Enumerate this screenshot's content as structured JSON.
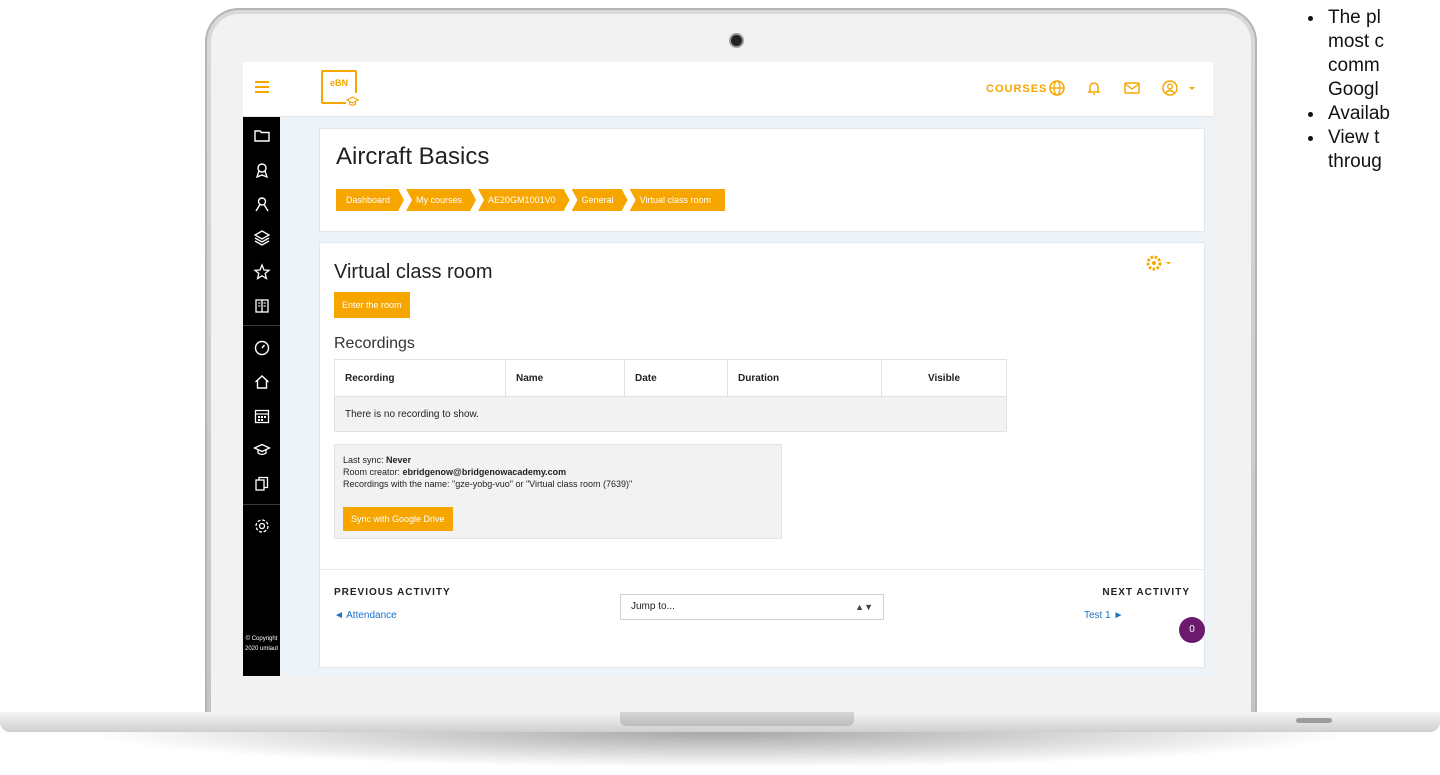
{
  "topbar": {
    "logo_text": "eBN",
    "courses_label": "COURSES"
  },
  "sidebar": {
    "copyright": "© Copyright 2020 umlaut"
  },
  "header": {
    "title": "Aircraft Basics",
    "breadcrumbs": [
      "Dashboard",
      "My courses",
      "AE20GM1001V0",
      "General",
      "Virtual class room"
    ]
  },
  "activity": {
    "title": "Virtual class room",
    "enter_button": "Enter the room",
    "recordings_heading": "Recordings",
    "table": {
      "columns": [
        "Recording",
        "Name",
        "Date",
        "Duration",
        "Visible"
      ],
      "empty_message": "There is no recording to show."
    },
    "sync": {
      "last_sync_label": "Last sync:",
      "last_sync_value": "Never",
      "room_creator_label": "Room creator:",
      "room_creator_value": "ebridgenow@bridgenowacademy.com",
      "recordings_name_line": "Recordings with the name: \"gze-yobg-vuo\" or \"Virtual class room (7639)\"",
      "button": "Sync with Google Drive"
    }
  },
  "navigation": {
    "previous_label": "PREVIOUS ACTIVITY",
    "previous_link": "◄ Attendance",
    "jump_placeholder": "Jump to...",
    "next_label": "NEXT ACTIVITY",
    "next_link": "Test 1 ►"
  },
  "badge_count": "0",
  "slide_notes": [
    "The pl",
    "most c",
    "comm",
    "Googl",
    "Availab",
    "View t",
    "throug"
  ],
  "colors": {
    "accent": "#f7a600",
    "sidebar": "#000000",
    "link": "#1a73c9",
    "badge": "#6a1b6e"
  }
}
